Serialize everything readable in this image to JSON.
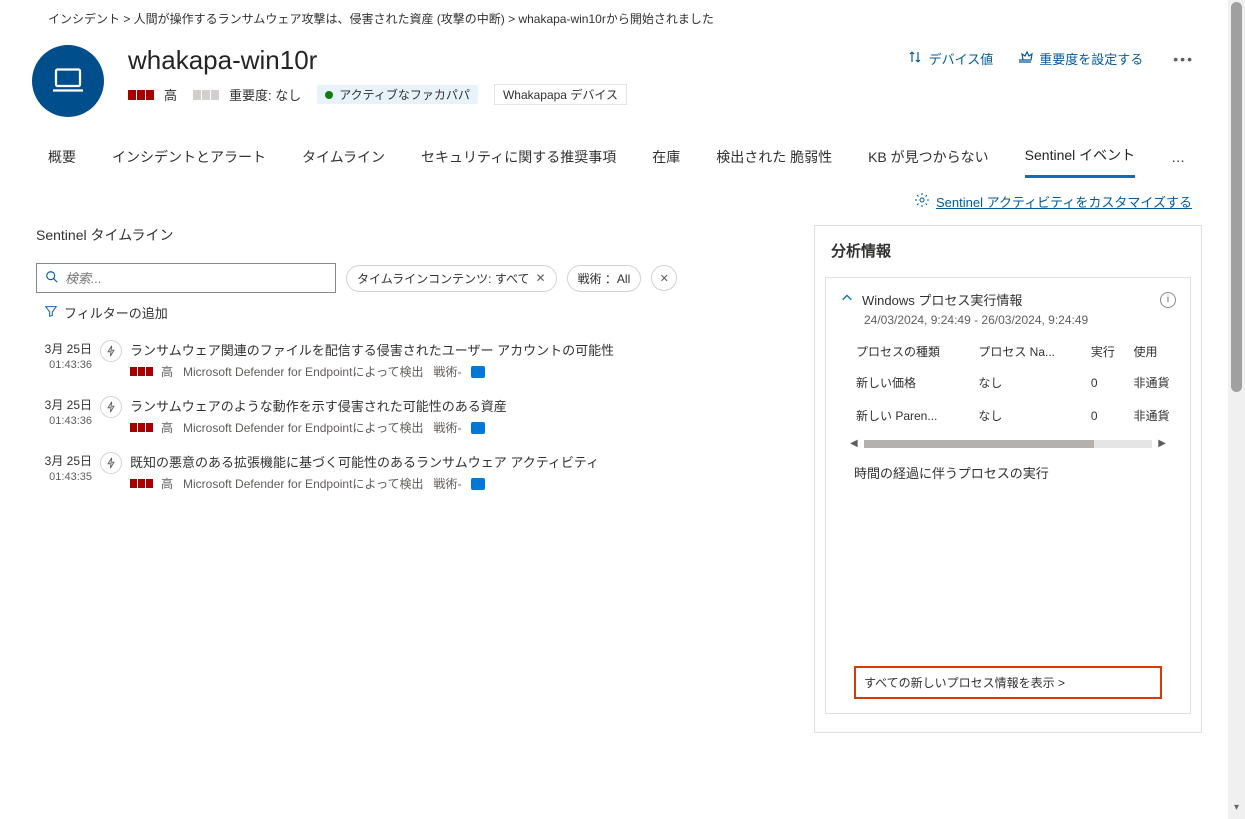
{
  "breadcrumb": "インシデント &gt;  人間が操作するランサムウェア攻撃は、侵害された資産 (攻撃の中断) &gt; whakapa-win10rから開始されました",
  "device": {
    "title": "whakapa-win10r",
    "sev_label": "高",
    "importance_label": "重要度: なし",
    "active_pill": "アクティブなファカパパ",
    "group_pill": "Whakapapa デバイス"
  },
  "header_actions": {
    "device_value": "デバイス値",
    "set_importance": "重要度を設定する"
  },
  "tabs": {
    "t0": "概要",
    "t1": "インシデントとアラート",
    "t2": "タイムライン",
    "t3": "セキュリティに関する推奨事項",
    "t4": "在庫",
    "t5": "検出された 脆弱性",
    "t6": "KB が見つからない",
    "t7": "Sentinel イベント",
    "more": "…"
  },
  "customize_link": "Sentinel アクティビティをカスタマイズする",
  "timeline": {
    "title": "Sentinel タイムライン",
    "search_placeholder": "検索...",
    "filter_contents": "タイムラインコンテンツ: すべて",
    "filter_tactics": "戦術 ：All",
    "filter_add": "フィルターの追加",
    "items": [
      {
        "date": "3月 25日",
        "time": "01:43:36",
        "title": "ランサムウェア関連のファイルを配信する侵害されたユーザー アカウントの可能性",
        "sev": "高",
        "source": "Microsoft Defender for Endpointによって検出",
        "tactic": "戦術-"
      },
      {
        "date": "3月 25日",
        "time": "01:43:36",
        "title": "ランサムウェアのような動作を示す侵害された可能性のある資産",
        "sev": "高",
        "source": "Microsoft Defender for Endpointによって検出",
        "tactic": "戦術-"
      },
      {
        "date": "3月 25日",
        "time": "01:43:35",
        "title": "既知の悪意のある拡張機能に基づく可能性のあるランサムウェア アクティビティ",
        "sev": "高",
        "source": "Microsoft Defender for Endpointによって検出",
        "tactic": "戦術-"
      }
    ]
  },
  "insights": {
    "panel_title": "分析情報",
    "card_title": "Windows プロセス実行情報",
    "date_range": "24/03/2024, 9:24:49 - 26/03/2024, 9:24:49",
    "headers": {
      "h1": "プロセスの種類",
      "h2": "プロセス Na...",
      "h3": "実行",
      "h4": "使用"
    },
    "rows": [
      {
        "c1": "新しい価格",
        "c2": "なし",
        "c3": "0",
        "c4": "非通貨"
      },
      {
        "c1": "新しい Paren...",
        "c2": "なし",
        "c3": "0",
        "c4": "非通貨"
      }
    ],
    "chart_title": "時間の経過に伴うプロセスの実行",
    "show_all": "すべての新しいプロセス情報を表示 &gt;"
  }
}
